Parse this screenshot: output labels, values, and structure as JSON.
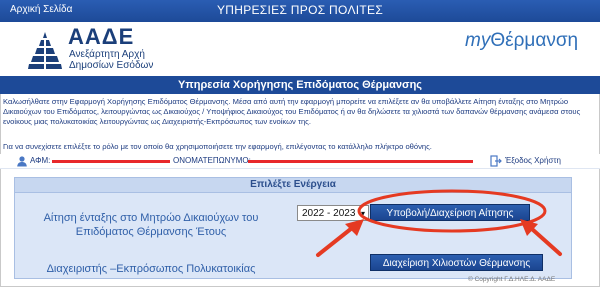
{
  "topbar": {
    "home_link": "Αρχική Σελίδα",
    "title": "ΥΠΗΡΕΣΙΕΣ ΠΡΟΣ ΠΟΛΙΤΕΣ"
  },
  "logo": {
    "name": "ΑΑΔΕ",
    "subtitle_line1": "Ανεξάρτητη Αρχή",
    "subtitle_line2": "Δημοσίων Εσόδων",
    "app_prefix": "my",
    "app_name": "Θέρμανση"
  },
  "service": {
    "title": "Υπηρεσία Χορήγησης Επιδόματος Θέρμανσης",
    "description": "Καλωσήλθατε στην Εφαρμογή Χορήγησης Επιδόματος Θέρμανσης. Μέσα από αυτή την εφαρμογή μπορείτε να επιλέξετε αν θα υποβάλλετε Αίτηση ένταξης στο Μητρώο Δικαιούχων του Επιδόματος, λειτουργώντας ως Δικαιούχος / Υποψήφιος Δικαιούχος του Επιδόματος ή αν θα δηλώσετε τα χιλιοστά των δαπανών θέρμανσης ανάμεσα στους ενοίκους μιας πολυκατοικίας λειτουργώντας ως Διαχειριστής-Εκπρόσωπος των ενοίκων της.",
    "instruction": "Για να συνεχίσετε επιλέξτε το ρόλο με τον οποίο θα χρησιμοποιήσετε την εφαρμογή, επιλέγοντας το κατάλληλο πλήκτρο οθόνης."
  },
  "user": {
    "afm_label": "ΑΦΜ:",
    "name_label": "ΟΝΟΜΑΤΕΠΩΝΥΜΟ:",
    "exit_label": "Έξοδος Χρήστη"
  },
  "panel": {
    "header": "Επιλέξτε Ενέργεια",
    "row1_label_line1": "Αίτηση ένταξης στο Μητρώο Δικαιούχων του",
    "row1_label_line2": "Επιδόματος Θέρμανσης Έτους",
    "year_value": "2022 - 2023",
    "submit_button": "Υποβολή/Διαχείριση Αίτησης",
    "row2_label": "Διαχειριστής –Εκπρόσωπος Πολυκατοικίας",
    "manage_button": "Διαχείριση Χιλιοστών Θέρμανσης"
  },
  "footer": {
    "copyright": "© Copyright Γ.Δ.ΗΛΕ.Δ. ΑΑΔΕ"
  },
  "colors": {
    "primary_blue": "#1d4a98",
    "panel_bg": "#dbe6f7",
    "annotation_red": "#e53a22"
  }
}
